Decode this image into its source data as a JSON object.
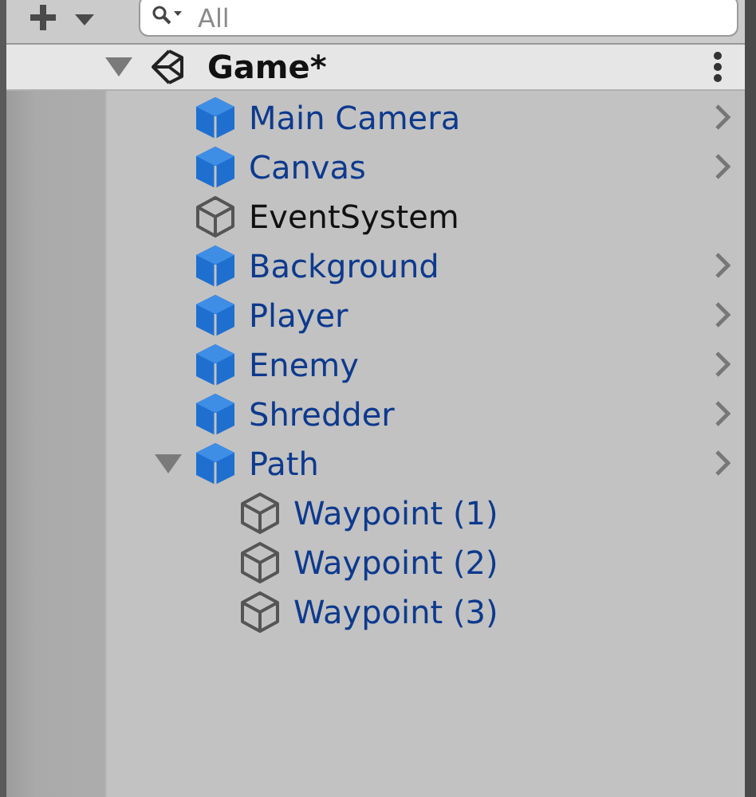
{
  "toolbar": {
    "search": {
      "placeholder": "All"
    }
  },
  "scene": {
    "name": "Game*",
    "expanded": true
  },
  "objects": [
    {
      "name": "Main Camera",
      "kind": "prefab"
    },
    {
      "name": "Canvas",
      "kind": "prefab"
    },
    {
      "name": "EventSystem",
      "kind": "object"
    },
    {
      "name": "Background",
      "kind": "prefab"
    },
    {
      "name": "Player",
      "kind": "prefab"
    },
    {
      "name": "Enemy",
      "kind": "prefab"
    },
    {
      "name": "Shredder",
      "kind": "prefab"
    },
    {
      "name": "Path",
      "kind": "prefab",
      "expanded": true,
      "children": [
        {
          "name": "Waypoint (1)",
          "kind": "prefab-part"
        },
        {
          "name": "Waypoint (2)",
          "kind": "prefab-part"
        },
        {
          "name": "Waypoint (3)",
          "kind": "prefab-part"
        }
      ]
    }
  ]
}
